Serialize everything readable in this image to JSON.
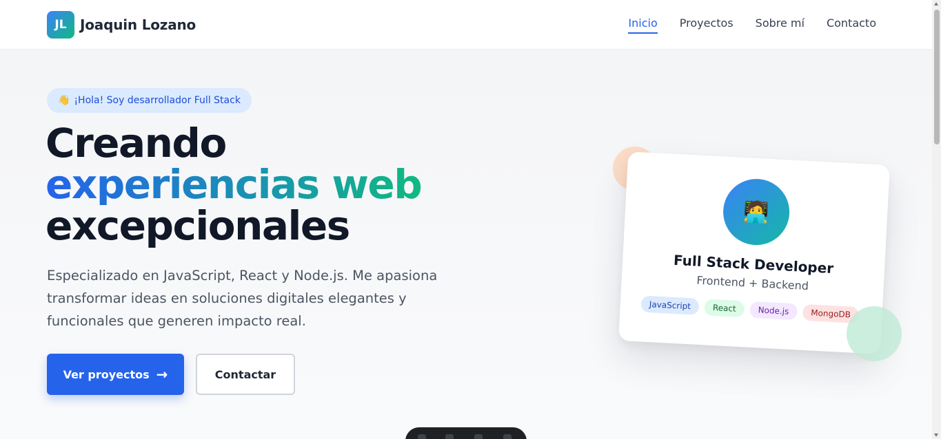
{
  "header": {
    "logo_initials": "JL",
    "brand_name": "Joaquin Lozano",
    "nav": [
      {
        "label": "Inicio",
        "active": true
      },
      {
        "label": "Proyectos",
        "active": false
      },
      {
        "label": "Sobre mí",
        "active": false
      },
      {
        "label": "Contacto",
        "active": false
      }
    ]
  },
  "hero": {
    "badge_icon": "waving-hand-icon",
    "badge_text": "¡Hola! Soy desarrollador Full Stack",
    "headline_line1": "Creando",
    "headline_line2": "experiencias web",
    "headline_line3": "excepcionales",
    "description": "Especializado en JavaScript, React y Node.js. Me apasiona transformar ideas en soluciones digitales elegantes y funcionales que generen impacto real.",
    "primary_button": "Ver proyectos",
    "primary_button_icon": "arrow-right-icon",
    "secondary_button": "Contactar"
  },
  "card": {
    "avatar_icon": "developer-emoji-icon",
    "title": "Full Stack Developer",
    "subtitle": "Frontend + Backend",
    "tags": [
      "JavaScript",
      "React",
      "Node.js",
      "MongoDB"
    ]
  },
  "colors": {
    "accent": "#2563eb",
    "gradient_end": "#10b981",
    "text_primary": "#111827",
    "text_secondary": "#4b5563"
  }
}
